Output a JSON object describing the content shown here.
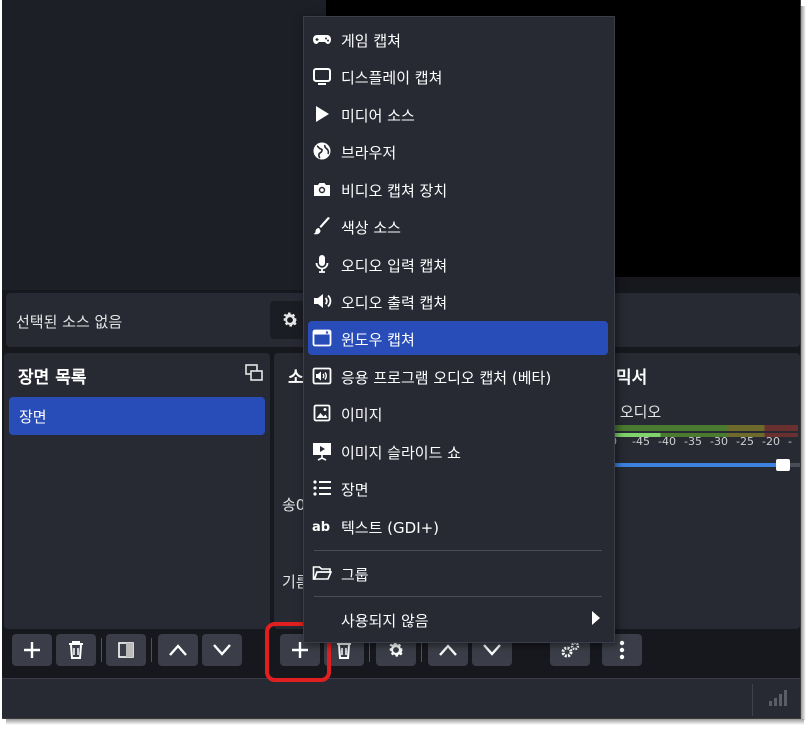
{
  "context_bar": {
    "no_source_label": "선택된 소스 없음"
  },
  "scenes_dock": {
    "title": "장면 목록",
    "items": [
      "장면"
    ]
  },
  "sources_dock": {
    "title_visible": "소",
    "hint_line1": "송0",
    "hint_line2": "기름"
  },
  "mixer_dock": {
    "title_visible": "믹서",
    "track_label_visible": "/ 오디오",
    "meter_ticks": [
      "0",
      "-45",
      "-40",
      "-35",
      "-30",
      "-25",
      "-20",
      "-"
    ]
  },
  "add_source_menu": {
    "items": [
      {
        "label": "게임 캡쳐",
        "icon": "gamepad-icon"
      },
      {
        "label": "디스플레이 캡쳐",
        "icon": "monitor-icon"
      },
      {
        "label": "미디어 소스",
        "icon": "play-icon"
      },
      {
        "label": "브라우저",
        "icon": "globe-icon"
      },
      {
        "label": "비디오 캡쳐 장치",
        "icon": "camera-icon"
      },
      {
        "label": "색상 소스",
        "icon": "paintbrush-icon"
      },
      {
        "label": "오디오 입력 캡쳐",
        "icon": "microphone-icon"
      },
      {
        "label": "오디오 출력 캡쳐",
        "icon": "speaker-icon"
      },
      {
        "label": "윈도우 캡쳐",
        "icon": "window-icon",
        "highlighted": true
      },
      {
        "label": "응용 프로그램 오디오 캡처 (베타)",
        "icon": "app-audio-icon"
      },
      {
        "label": "이미지",
        "icon": "image-icon"
      },
      {
        "label": "이미지 슬라이드 쇼",
        "icon": "slideshow-icon"
      },
      {
        "label": "장면",
        "icon": "list-icon"
      },
      {
        "label": "텍스트 (GDI+)",
        "icon": "text-ab-icon"
      }
    ],
    "group_label": "그룹",
    "group_icon": "folder-icon",
    "deprecated_label": "사용되지 않음"
  },
  "colors": {
    "accent": "#284cb8",
    "highlight_border": "#e02020",
    "panel": "#272a33",
    "preview": "#000000"
  }
}
